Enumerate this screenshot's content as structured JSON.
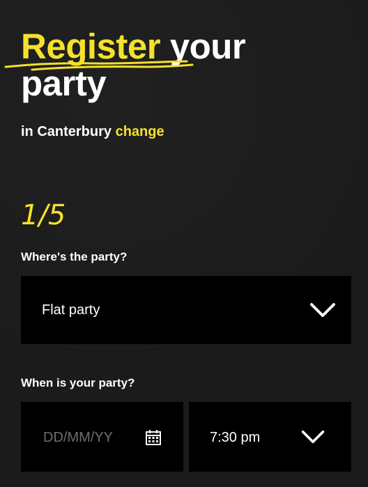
{
  "header": {
    "title_highlight": "Register",
    "title_rest": "your",
    "title_line2": "party"
  },
  "location": {
    "prefix": "in Canterbury",
    "change_label": "change"
  },
  "progress": {
    "step_label": "1/5"
  },
  "party_type": {
    "question": "Where's the party?",
    "selected": "Flat party"
  },
  "party_when": {
    "question": "When is your party?",
    "date_placeholder": "DD/MM/YY",
    "time_selected": "7:30 pm"
  },
  "colors": {
    "accent": "#f5e12b",
    "background": "#1b1b1b",
    "field_bg": "#000000"
  },
  "icons": [
    "scribble-underline",
    "chevron-down-icon",
    "calendar-icon"
  ]
}
